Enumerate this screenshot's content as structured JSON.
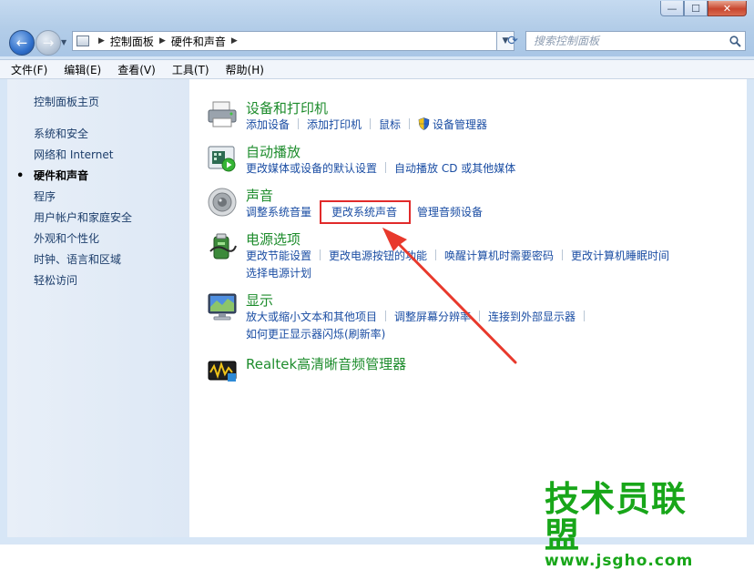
{
  "window": {
    "controls": {
      "minimize": "—",
      "maximize": "☐",
      "close": "✕"
    }
  },
  "nav": {
    "breadcrumb": [
      "控制面板",
      "硬件和声音"
    ],
    "search_placeholder": "搜索控制面板"
  },
  "menu": [
    "文件(F)",
    "编辑(E)",
    "查看(V)",
    "工具(T)",
    "帮助(H)"
  ],
  "sidebar": {
    "home": "控制面板主页",
    "items": [
      {
        "label": "系统和安全",
        "active": false
      },
      {
        "label": "网络和 Internet",
        "active": false
      },
      {
        "label": "硬件和声音",
        "active": true
      },
      {
        "label": "程序",
        "active": false
      },
      {
        "label": "用户帐户和家庭安全",
        "active": false
      },
      {
        "label": "外观和个性化",
        "active": false
      },
      {
        "label": "时钟、语言和区域",
        "active": false
      },
      {
        "label": "轻松访问",
        "active": false
      }
    ]
  },
  "categories": [
    {
      "title": "设备和打印机",
      "icon": "printer-icon",
      "links": [
        "添加设备",
        "添加打印机",
        "鼠标",
        "设备管理器"
      ]
    },
    {
      "title": "自动播放",
      "icon": "autoplay-icon",
      "links": [
        "更改媒体或设备的默认设置",
        "自动播放 CD 或其他媒体"
      ]
    },
    {
      "title": "声音",
      "icon": "speaker-icon",
      "links": [
        "调整系统音量",
        "更改系统声音",
        "管理音频设备"
      ]
    },
    {
      "title": "电源选项",
      "icon": "power-icon",
      "links": [
        "更改节能设置",
        "更改电源按钮的功能",
        "唤醒计算机时需要密码",
        "更改计算机睡眠时间"
      ],
      "links2": [
        "选择电源计划"
      ]
    },
    {
      "title": "显示",
      "icon": "display-icon",
      "links": [
        "放大或缩小文本和其他项目",
        "调整屏幕分辨率",
        "连接到外部显示器"
      ],
      "links2": [
        "如何更正显示器闪烁(刷新率)"
      ]
    },
    {
      "title": "Realtek高清晰音频管理器",
      "icon": "realtek-icon",
      "links": []
    }
  ],
  "watermark": {
    "text": "技术员联盟",
    "url": "www.jsgho.com"
  },
  "colors": {
    "link": "#1a4da3",
    "category_title": "#1d8c2c",
    "highlight": "#e12a2a"
  }
}
